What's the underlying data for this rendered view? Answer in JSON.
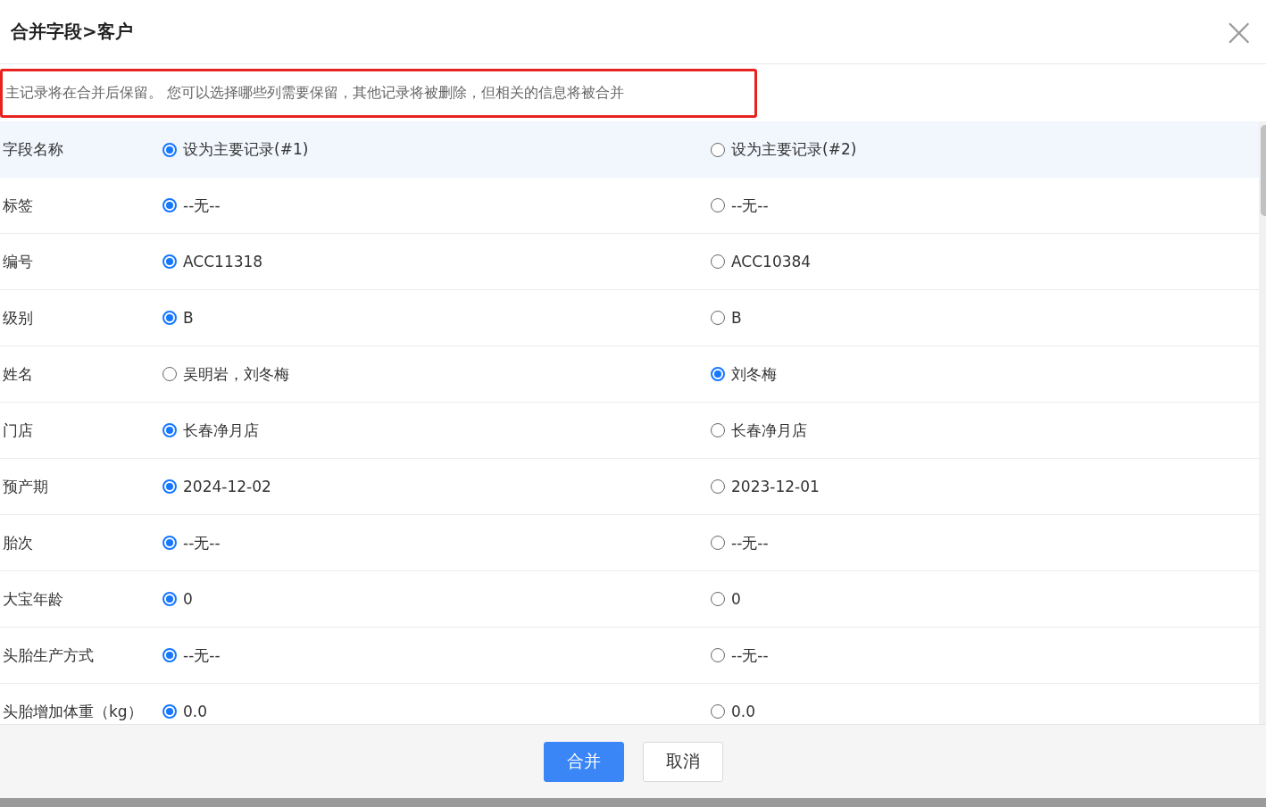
{
  "dialog": {
    "title": "合并字段>客户",
    "close": "×"
  },
  "notice": {
    "text": "主记录将在合并后保留。 您可以选择哪些列需要保留，其他记录将被删除，但相关的信息将被合并",
    "highlighted": true
  },
  "rows": [
    {
      "kind": "header",
      "label": "字段名称",
      "options": [
        {
          "text": "设为主要记录(#1)",
          "selected": true
        },
        {
          "text": "设为主要记录(#2)",
          "selected": false
        }
      ]
    },
    {
      "kind": "field",
      "label": "标签",
      "options": [
        {
          "text": "--无--",
          "selected": true
        },
        {
          "text": "--无--",
          "selected": false
        }
      ]
    },
    {
      "kind": "field",
      "label": "编号",
      "options": [
        {
          "text": "ACC11318",
          "selected": true
        },
        {
          "text": "ACC10384",
          "selected": false
        }
      ]
    },
    {
      "kind": "field",
      "label": "级别",
      "options": [
        {
          "text": "B",
          "selected": true
        },
        {
          "text": "B",
          "selected": false
        }
      ]
    },
    {
      "kind": "field",
      "label": "姓名",
      "options": [
        {
          "text": "吴明岩，刘冬梅",
          "selected": false
        },
        {
          "text": "刘冬梅",
          "selected": true
        }
      ]
    },
    {
      "kind": "field",
      "label": "门店",
      "options": [
        {
          "text": "长春净月店",
          "selected": true
        },
        {
          "text": "长春净月店",
          "selected": false
        }
      ]
    },
    {
      "kind": "field",
      "label": "预产期",
      "options": [
        {
          "text": "2024-12-02",
          "selected": true
        },
        {
          "text": "2023-12-01",
          "selected": false
        }
      ]
    },
    {
      "kind": "field",
      "label": "胎次",
      "options": [
        {
          "text": "--无--",
          "selected": true
        },
        {
          "text": "--无--",
          "selected": false
        }
      ]
    },
    {
      "kind": "field",
      "label": "大宝年龄",
      "options": [
        {
          "text": "0",
          "selected": true
        },
        {
          "text": "0",
          "selected": false
        }
      ]
    },
    {
      "kind": "field",
      "label": "头胎生产方式",
      "options": [
        {
          "text": "--无--",
          "selected": true
        },
        {
          "text": "--无--",
          "selected": false
        }
      ]
    },
    {
      "kind": "field",
      "label": "头胎增加体重（kg）",
      "options": [
        {
          "text": "0.0",
          "selected": true
        },
        {
          "text": "0.0",
          "selected": false
        }
      ]
    }
  ],
  "buttons": [
    {
      "label": "合并",
      "kind": "primary"
    },
    {
      "label": "取消",
      "kind": "secondary"
    }
  ]
}
